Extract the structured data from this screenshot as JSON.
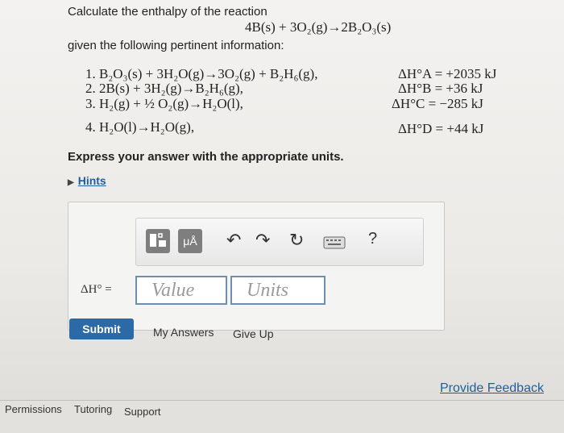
{
  "question": {
    "intro": "Calculate the enthalpy of the reaction",
    "reaction": "4B(s) + 3O₂(g)→2B₂O₃(s)",
    "given": "given the following pertinent information:",
    "steps": [
      {
        "label": "1. B₂O₃(s) + 3H₂O(g)→3O₂(g) + B₂H₆(g),",
        "dh": "ΔH°A = +2035 kJ"
      },
      {
        "label": "2. 2B(s) + 3H₂(g)→B₂H₆(g),",
        "dh": "ΔH°B = +36 kJ"
      },
      {
        "label": "3. H₂(g) + ½ O₂(g)→H₂O(l),",
        "dh": "ΔH°C = −285 kJ"
      },
      {
        "label": "4. H₂O(l)→H₂O(g),",
        "dh": "ΔH°D = +44 kJ"
      }
    ],
    "instruction": "Express your answer with the appropriate units."
  },
  "hints_label": "Hints",
  "toolbar": {
    "units_label": "μÅ",
    "help_label": "?"
  },
  "answer": {
    "label": "ΔH° =",
    "value_placeholder": "Value",
    "units_placeholder": "Units"
  },
  "actions": {
    "submit": "Submit",
    "my_answers": "My Answers",
    "give_up": "Give Up"
  },
  "feedback_link": "Provide Feedback",
  "footer": {
    "permissions": "Permissions",
    "tutoring": "Tutoring",
    "support": "Support"
  }
}
